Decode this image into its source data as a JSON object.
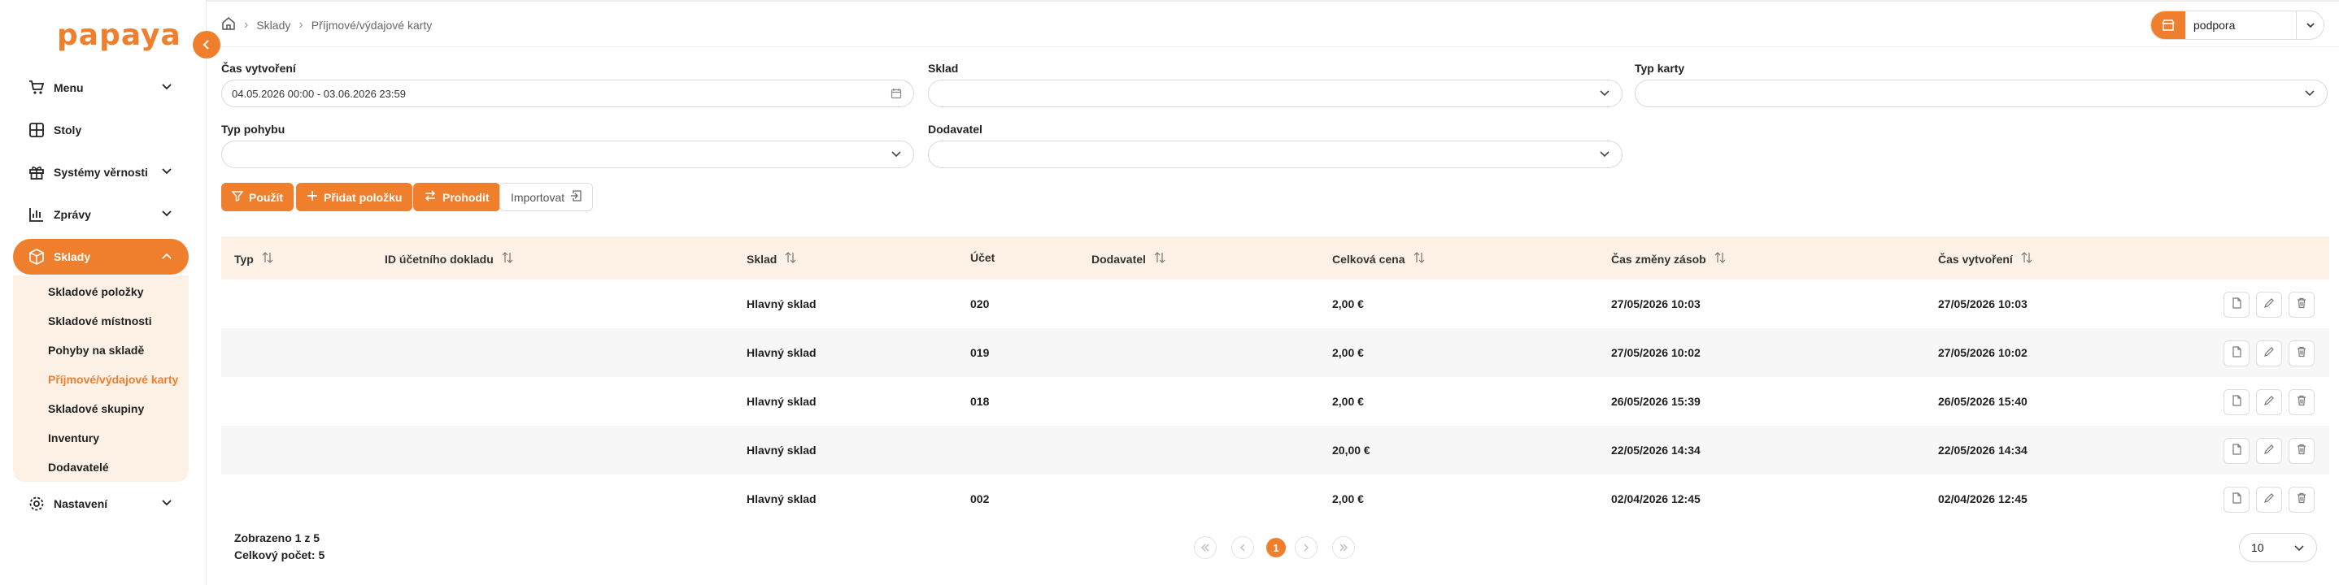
{
  "brand": {
    "logo_text": "papaya",
    "accent": "#f07f2d"
  },
  "sidebar": {
    "items": [
      {
        "label": "Menu",
        "icon": "cart-icon"
      },
      {
        "label": "Stoly",
        "icon": "grid-icon"
      },
      {
        "label": "Systémy věrnosti",
        "icon": "gift-icon"
      },
      {
        "label": "Zprávy",
        "icon": "chart-icon"
      },
      {
        "label": "Sklady",
        "icon": "box-icon"
      },
      {
        "label": "Nastavení",
        "icon": "gear-icon"
      }
    ],
    "submenu": [
      "Skladové položky",
      "Skladové místnosti",
      "Pohyby na skladě",
      "Příjmové/výdajové karty",
      "Skladové skupiny",
      "Inventury",
      "Dodavatelé"
    ]
  },
  "header": {
    "breadcrumb": [
      "Sklady",
      "Příjmové/výdajové karty"
    ],
    "user": "podpora"
  },
  "filters": {
    "created_label": "Čas vytvoření",
    "created_value": "04.05.2026 00:00 - 03.06.2026 23:59",
    "warehouse_label": "Sklad",
    "card_type_label": "Typ karty",
    "movement_type_label": "Typ pohybu",
    "supplier_label": "Dodavatel"
  },
  "actions": {
    "apply": "Použít",
    "add": "Přidat položku",
    "swap": "Prohodit",
    "import": "Importovat"
  },
  "table": {
    "columns": [
      "Typ",
      "ID účetního dokladu",
      "Sklad",
      "Účet",
      "Dodavatel",
      "Celková cena",
      "Čas změny zásob",
      "Čas vytvoření"
    ],
    "rows": [
      {
        "typ": "",
        "doc": "",
        "sklad": "Hlavný sklad",
        "ucet": "020",
        "dod": "",
        "cena": "2,00 €",
        "zmena": "27/05/2026 10:03",
        "vytvoreni": "27/05/2026 10:03"
      },
      {
        "typ": "",
        "doc": "",
        "sklad": "Hlavný sklad",
        "ucet": "019",
        "dod": "",
        "cena": "2,00 €",
        "zmena": "27/05/2026 10:02",
        "vytvoreni": "27/05/2026 10:02"
      },
      {
        "typ": "",
        "doc": "",
        "sklad": "Hlavný sklad",
        "ucet": "018",
        "dod": "",
        "cena": "2,00 €",
        "zmena": "26/05/2026 15:39",
        "vytvoreni": "26/05/2026 15:40"
      },
      {
        "typ": "",
        "doc": "",
        "sklad": "Hlavný sklad",
        "ucet": "",
        "dod": "",
        "cena": "20,00 €",
        "zmena": "22/05/2026 14:34",
        "vytvoreni": "22/05/2026 14:34"
      },
      {
        "typ": "",
        "doc": "",
        "sklad": "Hlavný sklad",
        "ucet": "002",
        "dod": "",
        "cena": "2,00 €",
        "zmena": "02/04/2026 12:45",
        "vytvoreni": "02/04/2026 12:45"
      }
    ]
  },
  "footer": {
    "shown": "Zobrazeno 1 z 5",
    "total": "Celkový počet: 5",
    "current_page": "1",
    "page_size": "10"
  }
}
